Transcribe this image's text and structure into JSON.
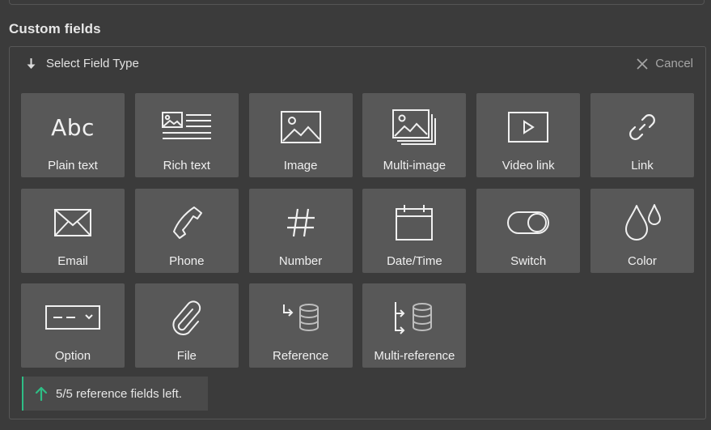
{
  "section": {
    "title": "Custom fields"
  },
  "picker": {
    "header_label": "Select Field Type",
    "cancel_label": "Cancel"
  },
  "field_types": [
    {
      "label": "Plain text",
      "icon": "abc-text-icon",
      "icon_text": "Abc"
    },
    {
      "label": "Rich text",
      "icon": "rich-text-icon"
    },
    {
      "label": "Image",
      "icon": "image-icon"
    },
    {
      "label": "Multi-image",
      "icon": "multi-image-icon"
    },
    {
      "label": "Video link",
      "icon": "video-play-icon"
    },
    {
      "label": "Link",
      "icon": "link-icon"
    },
    {
      "label": "Email",
      "icon": "envelope-icon"
    },
    {
      "label": "Phone",
      "icon": "phone-icon"
    },
    {
      "label": "Number",
      "icon": "hash-icon"
    },
    {
      "label": "Date/Time",
      "icon": "calendar-icon"
    },
    {
      "label": "Switch",
      "icon": "toggle-icon"
    },
    {
      "label": "Color",
      "icon": "droplets-icon"
    },
    {
      "label": "Option",
      "icon": "dropdown-select-icon"
    },
    {
      "label": "File",
      "icon": "paperclip-icon"
    },
    {
      "label": "Reference",
      "icon": "reference-database-icon"
    },
    {
      "label": "Multi-reference",
      "icon": "multi-reference-database-icon"
    }
  ],
  "notice": {
    "text": "5/5 reference fields left.",
    "accent_color": "#2ebd85"
  },
  "colors": {
    "background": "#3b3b3b",
    "tile": "#585858",
    "icon_stroke": "#f0f0f0"
  }
}
